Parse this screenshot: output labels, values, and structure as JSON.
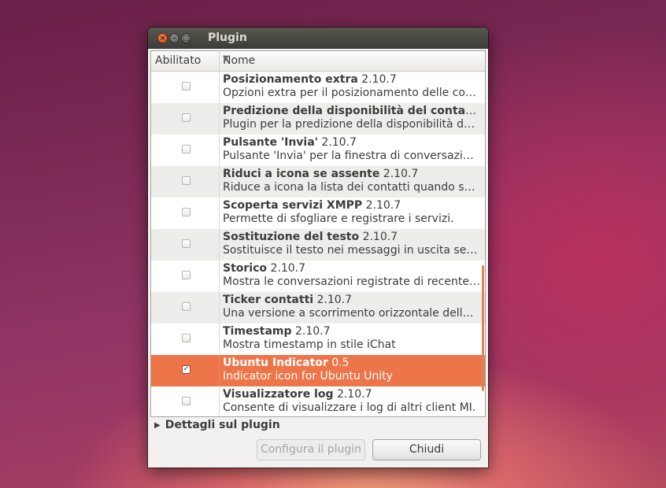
{
  "window": {
    "title": "Plugin"
  },
  "table": {
    "columns": {
      "enabled": "Abilitato",
      "name": "Nome"
    },
    "rows": [
      {
        "name": "Posizionamento extra",
        "version": "2.10.7",
        "description": "Opzioni extra per il posizionamento delle conversazioni.",
        "enabled": false
      },
      {
        "name": "Predizione della disponibilità del contatto",
        "version": "2.10.7",
        "description": "Plugin per la predizione della disponibilità del contatto.",
        "enabled": false
      },
      {
        "name": "Pulsante 'Invia'",
        "version": "2.10.7",
        "description": "Pulsante 'Invia' per la finestra di conversazione.",
        "enabled": false
      },
      {
        "name": "Riduci a icona se assente",
        "version": "2.10.7",
        "description": "Riduce a icona la lista dei contatti quando sei assente.",
        "enabled": false
      },
      {
        "name": "Scoperta servizi XMPP",
        "version": "2.10.7",
        "description": "Permette di sfogliare e registrare i servizi.",
        "enabled": false
      },
      {
        "name": "Sostituzione del testo",
        "version": "2.10.7",
        "description": "Sostituisce il testo nei messaggi in uscita secondo regole.",
        "enabled": false
      },
      {
        "name": "Storico",
        "version": "2.10.7",
        "description": "Mostra le conversazioni registrate di recente nelle nuove conversazioni.",
        "enabled": false
      },
      {
        "name": "Ticker contatti",
        "version": "2.10.7",
        "description": "Una versione a scorrimento orizzontale della lista contatti.",
        "enabled": false
      },
      {
        "name": "Timestamp",
        "version": "2.10.7",
        "description": "Mostra timestamp in stile iChat",
        "enabled": false
      },
      {
        "name": "Ubuntu Indicator",
        "version": "0.5",
        "description": "Indicator icon for Ubuntu Unity",
        "enabled": true,
        "selected": true
      },
      {
        "name": "Visualizzatore log",
        "version": "2.10.7",
        "description": "Consente di visualizzare i log di altri client MI.",
        "enabled": false
      }
    ]
  },
  "expander": {
    "label": "Dettagli sul plugin"
  },
  "buttons": {
    "configure": "Configura il plugin",
    "close": "Chiudi"
  },
  "colors": {
    "selection": "#ed7549",
    "titlebar": "#3c3b37"
  }
}
